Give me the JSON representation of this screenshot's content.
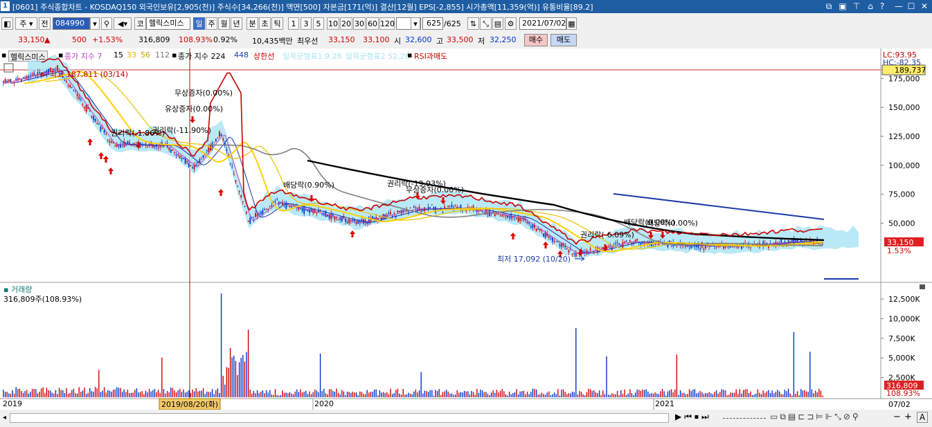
{
  "window": {
    "number": "1",
    "title": "[0601] 주식종합차트 - KOSDAQ150 외국인보유[2,905(천)] 주식수[34,266(천)] 액면[500] 자본금[171(억)] 결산[12월] EPS[-2,855] 시가총액[11,359(억)] 유통비율[89.2]"
  },
  "toolbar": {
    "market": "주",
    "all": "전",
    "code": "084990",
    "kospi_label": "코",
    "stock_name": "헬릭스미스",
    "periods": [
      "일",
      "주",
      "월",
      "년",
      "분",
      "초",
      "틱"
    ],
    "active_period": "일",
    "intervals": [
      "1",
      "3",
      "5",
      "10",
      "20",
      "30",
      "60",
      "120"
    ],
    "count": "625",
    "count_total": "/625",
    "date": "2021/07/02"
  },
  "quote": {
    "price": "33,150",
    "arrow": "▲",
    "change": "500",
    "change_pct": "+1.53%",
    "volume": "316,809",
    "volume_pct": "108.93%",
    "turnover_pct": "0.92%",
    "amount": "10,435백만",
    "best_ask_label": "최우선",
    "best_ask": "33,150",
    "best_bid": "33,100",
    "open_label": "시",
    "open": "32,600",
    "high_label": "고",
    "high": "33,500",
    "low_label": "저",
    "low": "32,250",
    "buy": "매수",
    "sell": "매도"
  },
  "legend": {
    "stock": "헬릭스미스",
    "ma_label": "종가 지수 7",
    "ma15": "15",
    "ma33": "33",
    "ma56": "56",
    "ma112": "112",
    "ma2_label": "종가 지수 224",
    "ma448": "448",
    "upper_limit": "상한선",
    "ichimoku1": "일목균형표1 9,26",
    "ichimoku2": "일목균형표2 52,26",
    "rsi": "RSI과매도"
  },
  "annotations": {
    "high": "최고 187,811 (03/14)",
    "low": "최저 17,092 (10/20)",
    "bonus1": "무상증자(0.00%)",
    "rights1": "유상증자(0.00%)",
    "ex1": "권리락(-1.86%)",
    "ex2": "권리락(-11.90%)",
    "div1": "배당락(0.90%)",
    "ex3": "권리락(-19.93%)",
    "bonus2": "무상증자(0.00%)",
    "ex4": "권리락(-6.09%)",
    "div2": "배당락(0.00%)",
    "div3": "배당락(0.00%)"
  },
  "price_axis": {
    "lc": "LC:93.95",
    "hc": "HC:-82.35",
    "cursor_value": "189,737",
    "ticks": [
      "175,000",
      "150,000",
      "125,000",
      "100,000",
      "75,000",
      "50,000"
    ],
    "current": "33,150",
    "current_pct": "1.53%"
  },
  "volume_panel": {
    "title": "거래량",
    "value": "316,809주(108.93%)",
    "ticks": [
      "12,500K",
      "10,000K",
      "7,500K",
      "5,000K",
      "2,500K"
    ],
    "current": "316,809",
    "current_pct": "108.93%"
  },
  "x_axis": {
    "labels": [
      "2019",
      "2020",
      "2021"
    ],
    "cursor_date": "2019/08/20(화)",
    "end_date": "07/02"
  },
  "colors": {
    "title_bg": "#1f5da3",
    "up": "#d00000",
    "down": "#0033cc",
    "ma7": "#c040c0",
    "ma33": "#ffd000",
    "ma56": "#e8c000",
    "cloud": "#a8e4f4",
    "ma224": "#808080",
    "ma448": "#000000",
    "limit": "#cc0000",
    "trend": "#1a3aa8"
  },
  "chart_data": {
    "type": "line",
    "title": "",
    "series": [
      {
        "name": "헬릭스미스",
        "x": [
          "2019-01",
          "2019-03",
          "2019-05",
          "2019-07",
          "2019-08",
          "2019-09",
          "2019-10",
          "2019-11",
          "2019-12",
          "2020-02",
          "2020-04",
          "2020-06",
          "2020-08",
          "2020-10",
          "2020-12",
          "2021-02",
          "2021-04",
          "2021-06",
          "2021-07"
        ],
        "values": [
          171000,
          183000,
          118000,
          117000,
          98000,
          128000,
          51000,
          68000,
          62000,
          50000,
          62000,
          63000,
          54000,
          23000,
          34000,
          31000,
          30000,
          34000,
          33150
        ]
      }
    ],
    "volume_x": [
      "2019-09",
      "2019-10",
      "2020-10",
      "2021-06"
    ],
    "volume_values": [
      13200,
      8600,
      8800,
      8300
    ],
    "ylim": [
      0,
      195000
    ],
    "volume_ylim": [
      0,
      14000
    ]
  }
}
